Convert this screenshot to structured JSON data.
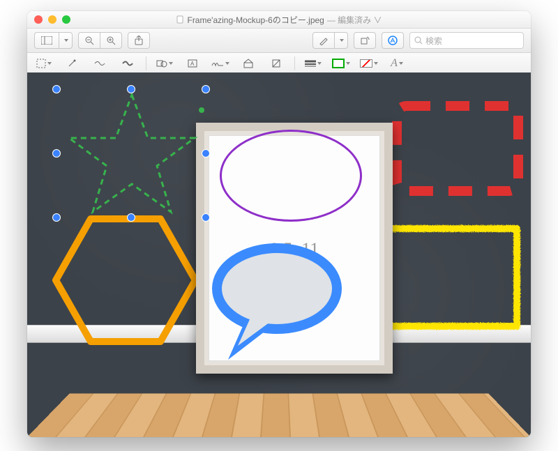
{
  "titlebar": {
    "filename": "Frame'azing-Mockup-6のコピー.jpeg",
    "status": "— 編集済み ∨"
  },
  "toolbar1": {
    "search_placeholder": "検索"
  },
  "canvas": {
    "frame_label": "8.5x11"
  },
  "colors": {
    "star": "#37b24d",
    "hexagon": "#f59f00",
    "rect_dashed": "#e03131",
    "rect_crayon": "#ffe600",
    "ellipse": "#8e2fc9",
    "speech": "#3b8bff",
    "handle": "#3a82ff"
  }
}
